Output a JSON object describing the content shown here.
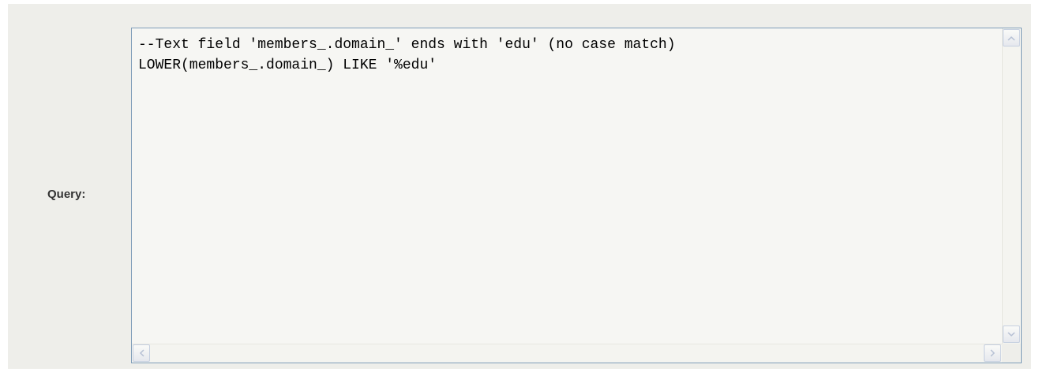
{
  "form": {
    "query_label": "Query:",
    "query_value": "--Text field 'members_.domain_' ends with 'edu' (no case match)\nLOWER(members_.domain_) LIKE '%edu'"
  },
  "icons": {
    "scroll_up": "chevron-up-icon",
    "scroll_down": "chevron-down-icon",
    "scroll_left": "chevron-left-icon",
    "scroll_right": "chevron-right-icon"
  },
  "colors": {
    "panel_background": "#eeeeea",
    "field_border": "#7f9db9",
    "field_background": "#f6f6f3"
  }
}
